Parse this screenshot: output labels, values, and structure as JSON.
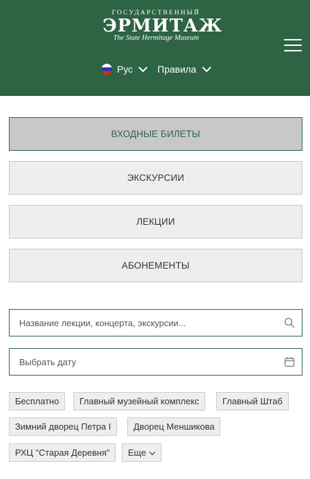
{
  "header": {
    "logo": {
      "top_line": "ГОСУДАРСТВЕННЫЙ",
      "main": "ЭРМИТАЖ",
      "subtitle": "The State Hermitage Museum"
    },
    "language": {
      "label": "Рус",
      "icon": "russia-flag-icon"
    },
    "rules_label": "Правила",
    "menu_icon": "hamburger-menu-icon",
    "color": "#2e6344"
  },
  "tabs": [
    {
      "label": "ВХОДНЫЕ БИЛЕТЫ",
      "active": true
    },
    {
      "label": "ЭКСКУРСИИ",
      "active": false
    },
    {
      "label": "ЛЕКЦИИ",
      "active": false
    },
    {
      "label": "АБОНЕМЕНТЫ",
      "active": false
    }
  ],
  "search": {
    "placeholder": "Название лекции, концерта, экскурсии...",
    "value": "",
    "icon": "search-icon"
  },
  "date": {
    "placeholder": "Выбрать дату",
    "value": "",
    "icon": "calendar-icon"
  },
  "filters": {
    "chips": [
      {
        "label": "Бесплатно"
      },
      {
        "label": "Главный музейный комплекс"
      },
      {
        "label": "Главный Штаб"
      },
      {
        "label": "Зимний дворец Петра I"
      },
      {
        "label": "Дворец Меншикова"
      },
      {
        "label": "РХЦ \"Старая Деревня\""
      }
    ],
    "more_label": "Еще"
  }
}
